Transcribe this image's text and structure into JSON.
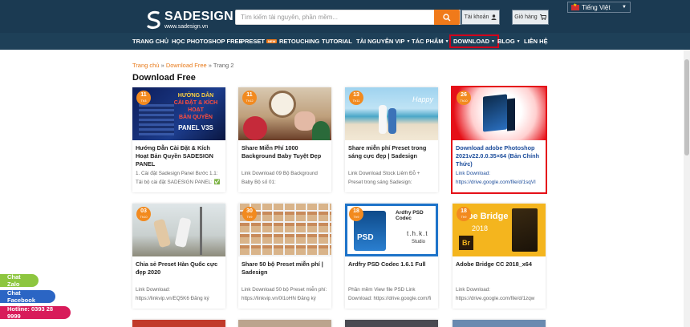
{
  "header": {
    "logo_name": "SADESIGN",
    "logo_url": "www.sadesign.vn",
    "search_placeholder": "Tìm kiếm tài nguyên, phần mềm...",
    "account_label": "Tài khoản",
    "cart_label": "Giỏ hàng",
    "language": "Tiếng Việt"
  },
  "nav": {
    "items": [
      "TRANG CHỦ",
      "HỌC PHOTOSHOP FREE",
      "PRESET",
      "RETOUCHING",
      "TUTORIAL",
      "TÀI NGUYÊN VIP",
      "TÁC PHẨM",
      "DOWNLOAD",
      "BLOG",
      "LIÊN HỆ"
    ],
    "new_badge": "NEW"
  },
  "breadcrumb": {
    "home": "Trang chủ",
    "sep1": " » ",
    "section": "Download Free",
    "sep2": " » ",
    "current": "Trang 2"
  },
  "page_title": "Download Free",
  "cards": [
    {
      "day": "11",
      "month": "Th3",
      "title": "Hướng Dẫn Cài Đặt & Kích Hoạt Bản Quyền SADESIGN PANEL",
      "excerpt": "1. Cài đặt Sadesign Panel Bước 1.1:\nTải bộ cài đặt SADESIGN PANEL: ✅",
      "thumb_text": [
        "HƯỚNG DẪN",
        "CÀI ĐẶT & KÍCH HOẠT",
        "BẢN QUYỀN",
        "PANEL V3S"
      ]
    },
    {
      "day": "11",
      "month": "Th12",
      "title": "Share Miễn Phí 1000 Background Baby Tuyệt Đẹp",
      "excerpt": "Link Download 09 Bộ Background\nBaby Bộ số 01:"
    },
    {
      "day": "13",
      "month": "Th11",
      "title": "Share miễn phí Preset trong sáng cực đẹp | Sadesign",
      "excerpt": "Link Download Stock Liêm Đỗ +\nPreset trong sáng Sadesign:"
    },
    {
      "day": "26",
      "month": "Th10",
      "title": "Download adobe Photoshop 2021v22.0.0.35×64 (Bản Chính Thức)",
      "excerpt": "Link Download:\nhttps://drive.google.com/file/d/1sqVI"
    },
    {
      "day": "03",
      "month": "Th10",
      "title": "Chia sẻ Preset Hàn Quốc cực đẹp 2020",
      "excerpt": "Link Download:\nhttps://linkvip.vn/EQ5K6 Đăng ký"
    },
    {
      "day": "30",
      "month": "Th9",
      "title": "Share 50 bộ Preset miễn phí | Sadesign",
      "excerpt": "Link Download 50 bộ Preset miễn phí:\nhttps://linkvip.vn/0I1oHN Đăng ký"
    },
    {
      "day": "18",
      "month": "Th9",
      "title": "Ardfry PSD Codec 1.6.1 Full",
      "excerpt": "Phần mềm View file PSD Link\nDownload: https://drive.google.com/fi",
      "thumb_text": [
        "Ardfry PSD Codec",
        "PSD",
        "t.h.k.t",
        "Studio"
      ]
    },
    {
      "day": "18",
      "month": "Th9",
      "title": "Adobe Bridge CC 2018_x64",
      "excerpt": "Link Download:\nhttps://drive.google.com/file/d/1zqw",
      "thumb_text": [
        "obe Bridge",
        "2018",
        "Br"
      ]
    }
  ],
  "floating": {
    "zalo": "Chat Zalo",
    "facebook": "Chat Facebook",
    "hotline": "Hotline: 0393 28 9999"
  },
  "colors": {
    "header": "#1b3a52",
    "accent": "#f07a1a",
    "zalo": "#8dc63f",
    "facebook": "#2b65c4",
    "hotline": "#d81b5a"
  }
}
